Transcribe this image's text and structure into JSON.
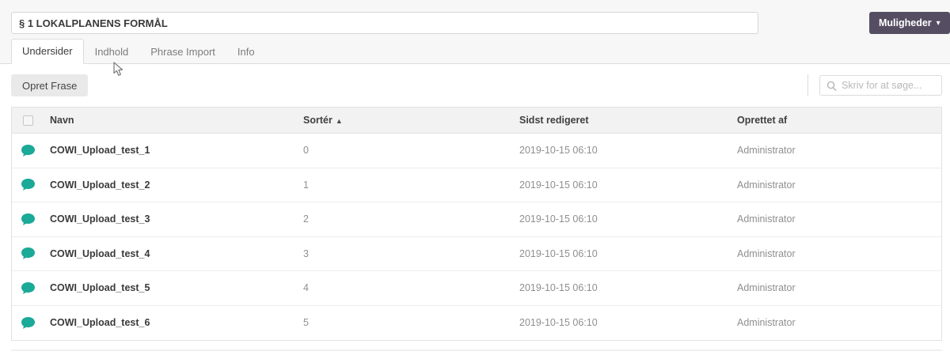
{
  "header": {
    "title_value": "§ 1 LOKALPLANENS FORMÅL",
    "options_button": "Muligheder"
  },
  "tabs": [
    {
      "label": "Undersider",
      "active": true
    },
    {
      "label": "Indhold",
      "active": false
    },
    {
      "label": "Phrase Import",
      "active": false
    },
    {
      "label": "Info",
      "active": false
    }
  ],
  "toolbar": {
    "create_button": "Opret Frase",
    "search_placeholder": "Skriv for at søge..."
  },
  "table": {
    "columns": {
      "name": "Navn",
      "sort": "Sortér",
      "last_edited": "Sidst redigeret",
      "created_by": "Oprettet af"
    },
    "sort_column": "Sortér",
    "sort_direction": "ascending",
    "rows": [
      {
        "name": "COWI_Upload_test_1",
        "sort": "0",
        "last_edited": "2019-10-15 06:10",
        "created_by": "Administrator"
      },
      {
        "name": "COWI_Upload_test_2",
        "sort": "1",
        "last_edited": "2019-10-15 06:10",
        "created_by": "Administrator"
      },
      {
        "name": "COWI_Upload_test_3",
        "sort": "2",
        "last_edited": "2019-10-15 06:10",
        "created_by": "Administrator"
      },
      {
        "name": "COWI_Upload_test_4",
        "sort": "3",
        "last_edited": "2019-10-15 06:10",
        "created_by": "Administrator"
      },
      {
        "name": "COWI_Upload_test_5",
        "sort": "4",
        "last_edited": "2019-10-15 06:10",
        "created_by": "Administrator"
      },
      {
        "name": "COWI_Upload_test_6",
        "sort": "5",
        "last_edited": "2019-10-15 06:10",
        "created_by": "Administrator"
      }
    ]
  },
  "icons": {
    "sort_asc": "▲",
    "caret_down": "▾"
  },
  "colors": {
    "accent_teal": "#1ba998",
    "button_purple": "#554e62"
  }
}
